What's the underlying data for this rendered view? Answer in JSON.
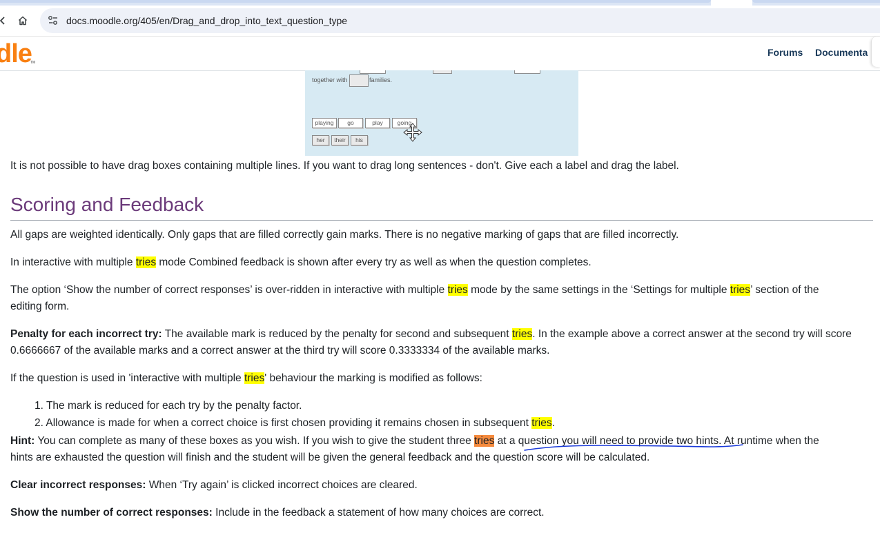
{
  "browser": {
    "url": "docs.moodle.org/405/en/Drag_and_drop_into_text_question_type"
  },
  "header": {
    "logo_text": "dle",
    "logo_tm": "TM",
    "nav": [
      "Forums",
      "Documenta"
    ]
  },
  "demo": {
    "text_together": "together with",
    "text_families": "families.",
    "chips_row1": [
      "playing",
      "go",
      "play",
      "going"
    ],
    "chips_row2": [
      "her",
      "their",
      "his"
    ]
  },
  "article": {
    "intro": "It is not possible to have drag boxes containing multiple lines. If you want to drag long sentences - don't. Give each a label and drag the label.",
    "section_title": "Scoring and Feedback",
    "p1": "All gaps are weighted identically. Only gaps that are filled correctly gain marks. There is no negative marking of gaps that are filled incorrectly.",
    "p2": {
      "a": "In interactive with multiple ",
      "hl": "tries",
      "b": " mode Combined feedback is shown after every try as well as when the question completes."
    },
    "p3": {
      "a": "The option ‘Show the number of correct responses’ is over-ridden in interactive with multiple ",
      "hl1": "tries",
      "b": " mode by the same settings in the ‘Settings for multiple ",
      "hl2": "tries",
      "c": "’ section of the",
      "line2": "editing form."
    },
    "p4": {
      "label": "Penalty for each incorrect try:",
      "a": " The available mark is reduced by the penalty for second and subsequent ",
      "hl": "tries",
      "b": ". In the example above a correct answer at the second try will score",
      "line2": "0.6666667 of the available marks and a correct answer at the third try will score 0.3333334 of the available marks."
    },
    "p5": {
      "a": "If the question is used in 'interactive with multiple ",
      "hl": "tries",
      "b": "' behaviour the marking is modified as follows:"
    },
    "list": [
      {
        "num": "1.",
        "text": "The mark is reduced for each try by the penalty factor."
      },
      {
        "num": "2.",
        "text": "Allowance is made for when a correct choice is first chosen providing it remains chosen in subsequent ",
        "hl": "tries",
        "end": "."
      }
    ],
    "hint": {
      "label": "Hint:",
      "a": " You can complete as many of these boxes as you wish. If you wish to give the student three ",
      "hl": "tries",
      "b": " at a question you will need to provide two hints. At runtime when the",
      "line2": "hints are exhausted the question will finish and the student will be given the general feedback and the question score will be calculated."
    },
    "clear": {
      "label": "Clear incorrect responses:",
      "text": " When ‘Try again’ is clicked incorrect choices are cleared."
    },
    "show": {
      "label": "Show the number of correct responses:",
      "text": " Include in the feedback a statement of how many choices are correct."
    }
  },
  "colors": {
    "highlight": "#ffff00",
    "highlight_active": "#f58a3d",
    "heading": "#6b3a7a",
    "logo": "#f98012",
    "demo_bg": "#d7eaf3",
    "ink": "#1a3adb"
  },
  "icons": [
    "back-icon",
    "home-icon",
    "site-info-icon",
    "move-cursor-icon"
  ]
}
